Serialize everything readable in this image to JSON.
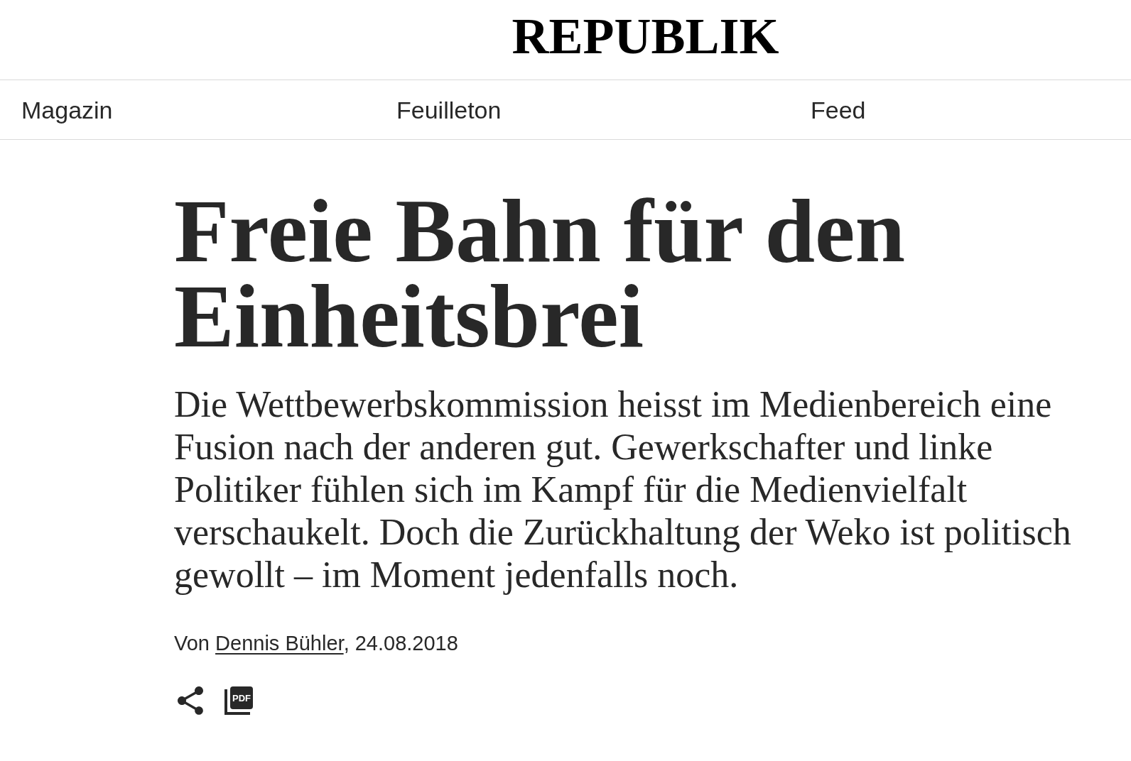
{
  "header": {
    "logo": "REPUBLIK"
  },
  "nav": [
    "Magazin",
    "Feuilleton",
    "Feed"
  ],
  "article": {
    "title": "Freie Bahn für den Einheitsbrei",
    "lead": "Die Wettbewerbskommission heisst im Medienbereich eine Fusion nach der anderen gut. Gewerkschafter und linke Politiker fühlen sich im Kampf für die Medienvielfalt verschaukelt. Doch die Zurückhaltung der Weko ist politisch gewollt – im Moment jedenfalls noch.",
    "byline": {
      "prefix": "Von",
      "author": "Dennis Bühler",
      "suffix": ", 24.08.2018"
    },
    "actions": [
      {
        "kind": "share"
      },
      {
        "kind": "pdf",
        "label": "PDF"
      }
    ]
  }
}
